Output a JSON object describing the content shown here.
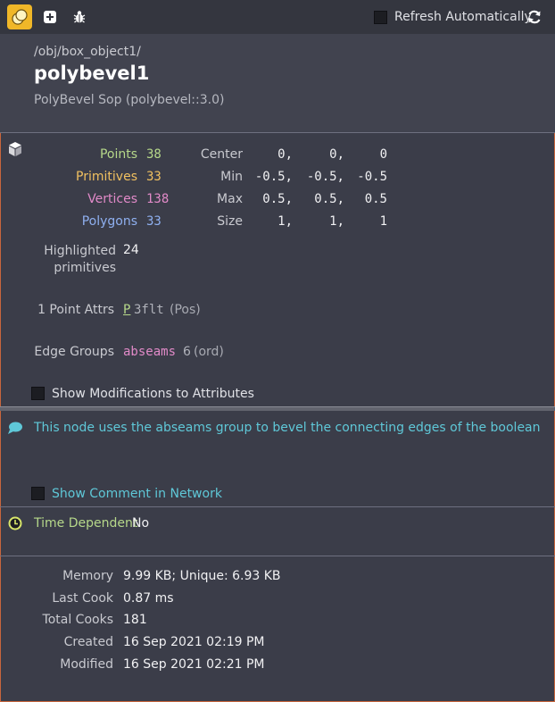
{
  "toolbar": {
    "refresh_label": "Refresh Automatically"
  },
  "header": {
    "path": "/obj/box_object1/",
    "title": "polybevel1",
    "subtitle": "PolyBevel Sop (polybevel::3.0)"
  },
  "stats": [
    {
      "label": "Points",
      "value": "38",
      "color": "#b6d88a"
    },
    {
      "label": "Primitives",
      "value": "33",
      "color": "#f0c060"
    },
    {
      "label": "Vertices",
      "value": "138",
      "color": "#e18ac8"
    },
    {
      "label": "Polygons",
      "value": "33",
      "color": "#8fb0f0"
    }
  ],
  "geometry": [
    {
      "label": "Center",
      "x": "0,",
      "y": "0,",
      "z": "0"
    },
    {
      "label": "Min",
      "x": "-0.5,",
      "y": "-0.5,",
      "z": "-0.5"
    },
    {
      "label": "Max",
      "x": "0.5,",
      "y": "0.5,",
      "z": "0.5"
    },
    {
      "label": "Size",
      "x": "1,",
      "y": "1,",
      "z": "1"
    }
  ],
  "highlighted": {
    "label_line1": "Highlighted",
    "label_line2": "primitives",
    "value": "24"
  },
  "point_attrs": {
    "label": "1 Point Attrs",
    "name": "P",
    "type": "3flt",
    "note": "(Pos)"
  },
  "edge_groups": {
    "label": "Edge Groups",
    "name": "abseams",
    "count": "6",
    "note": "(ord)"
  },
  "show_modifications": "Show Modifications to Attributes",
  "comment": {
    "text": "This node uses the abseams group to bevel the connecting edges of the boolean",
    "show_label": "Show Comment in Network"
  },
  "time_dependent": {
    "label": "Time Dependent",
    "value": "No"
  },
  "info": [
    {
      "label": "Memory",
      "value": "9.99 KB; Unique: 6.93 KB"
    },
    {
      "label": "Last Cook",
      "value": "0.87 ms"
    },
    {
      "label": "Total Cooks",
      "value": "181"
    },
    {
      "label": "Created",
      "value": "16 Sep 2021 02:19 PM"
    },
    {
      "label": "Modified",
      "value": "16 Sep 2021 02:21 PM"
    }
  ],
  "colors": {
    "accent": "#f0b728",
    "comment": "#5fc8d8",
    "time_label": "#b6d88a"
  }
}
